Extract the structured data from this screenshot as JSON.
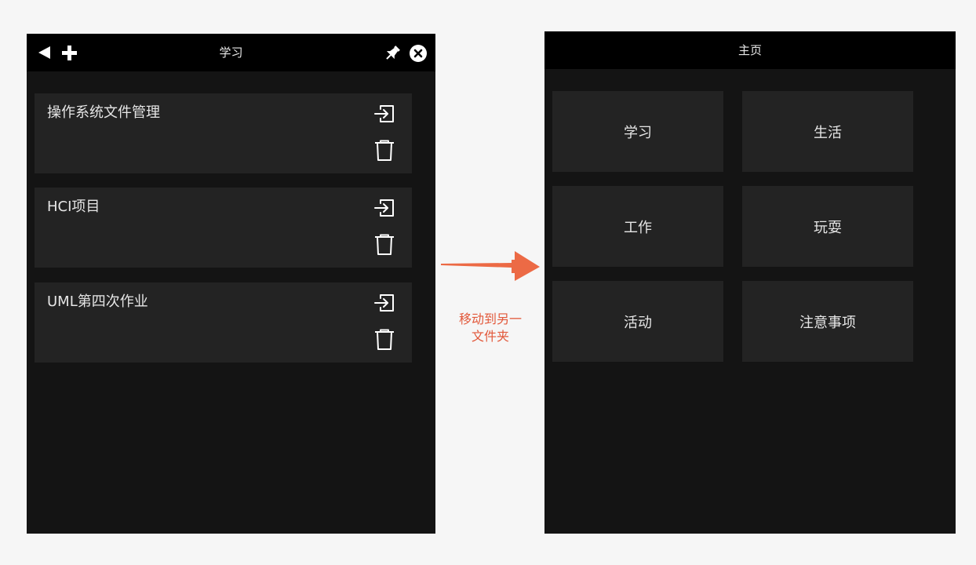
{
  "left_panel": {
    "title": "学习",
    "toolbar": {
      "back_icon": "back-triangle-icon",
      "add_icon": "plus-icon",
      "pin_icon": "pin-icon",
      "close_icon": "close-circle-icon"
    },
    "notes": [
      {
        "title": "操作系统文件管理"
      },
      {
        "title": "HCI项目"
      },
      {
        "title": "UML第四次作业"
      }
    ]
  },
  "annotation": {
    "line1": "移动到另一",
    "line2": "文件夹",
    "color": "#ec6a45"
  },
  "right_panel": {
    "title": "主页",
    "folders": [
      {
        "label": "学习"
      },
      {
        "label": "生活"
      },
      {
        "label": "工作"
      },
      {
        "label": "玩耍"
      },
      {
        "label": "活动"
      },
      {
        "label": "注意事项"
      }
    ]
  },
  "colors": {
    "page_bg": "#f6f6f6",
    "panel_bg": "#141414",
    "titlebar_bg": "#000000",
    "card_bg": "#232323",
    "text": "#e6e6e6",
    "accent": "#ec6a45"
  }
}
